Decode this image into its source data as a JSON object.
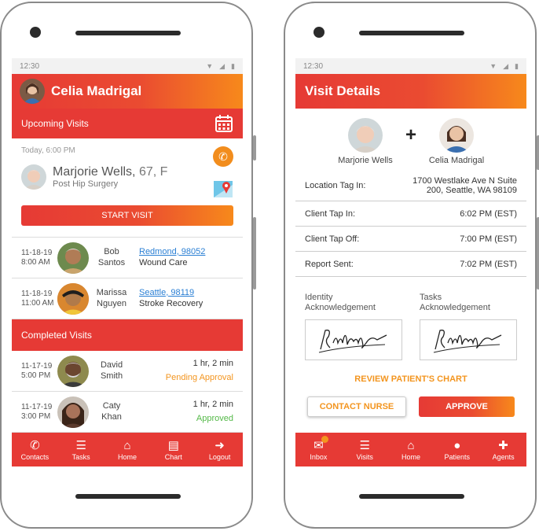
{
  "colors": {
    "accent": "#e63a35",
    "orange": "#f7891b",
    "link": "#2a7fd4",
    "pending": "#f3951f",
    "approved": "#54b948"
  },
  "left": {
    "status_time": "12:30",
    "header_name": "Celia Madrigal",
    "upcoming_title": "Upcoming Visits",
    "next_visit": {
      "time": "Today, 6:00 PM",
      "patient_name": "Marjorie Wells,",
      "patient_age": " 67, F",
      "reason": "Post Hip Surgery",
      "start_label": "START VISIT"
    },
    "upcoming": [
      {
        "date1": "11-18-19",
        "date2": "8:00 AM",
        "first": "Bob",
        "last": "Santos",
        "location": "Redmond, 98052",
        "reason": "Wound Care"
      },
      {
        "date1": "11-18-19",
        "date2": "11:00 AM",
        "first": "Marissa",
        "last": "Nguyen",
        "location": "Seattle, 98119",
        "reason": "Stroke Recovery"
      }
    ],
    "completed_title": "Completed Visits",
    "completed": [
      {
        "date1": "11-17-19",
        "date2": "5:00 PM",
        "first": "David",
        "last": "Smith",
        "duration": "1 hr, 2 min",
        "status": "Pending Approval"
      },
      {
        "date1": "11-17-19",
        "date2": "3:00 PM",
        "first": "Caty",
        "last": "Khan",
        "duration": "1 hr, 2 min",
        "status": "Approved"
      }
    ],
    "nav": [
      {
        "label": "Contacts",
        "icon": "phone-icon"
      },
      {
        "label": "Tasks",
        "icon": "list-icon"
      },
      {
        "label": "Home",
        "icon": "home-icon"
      },
      {
        "label": "Chart",
        "icon": "clipboard-icon"
      },
      {
        "label": "Logout",
        "icon": "arrow-right-icon"
      }
    ]
  },
  "right": {
    "status_time": "12:30",
    "header_title": "Visit Details",
    "patient": "Marjorie Wells",
    "nurse": "Celia Madrigal",
    "plus": "+",
    "details": [
      {
        "label": "Location Tag In:",
        "value1": "1700 Westlake Ave N Suite",
        "value2": "200, Seattle, WA 98109"
      },
      {
        "label": "Client Tap In:",
        "value1": "6:02 PM (EST)",
        "value2": ""
      },
      {
        "label": "Client Tap Off:",
        "value1": "7:00 PM (EST)",
        "value2": ""
      },
      {
        "label": "Report Sent:",
        "value1": "7:02 PM (EST)",
        "value2": ""
      }
    ],
    "ack_identity_1": "Identity",
    "ack_identity_2": "Acknowledgement",
    "ack_tasks_1": "Tasks",
    "ack_tasks_2": "Acknowledgement",
    "review_label": "REVIEW PATIENT'S CHART",
    "contact_label": "CONTACT NURSE",
    "approve_label": "APPROVE",
    "nav": [
      {
        "label": "Inbox",
        "icon": "mail-icon"
      },
      {
        "label": "Visits",
        "icon": "list-icon"
      },
      {
        "label": "Home",
        "icon": "home-icon"
      },
      {
        "label": "Patients",
        "icon": "person-icon"
      },
      {
        "label": "Agents",
        "icon": "medkit-icon"
      }
    ]
  }
}
